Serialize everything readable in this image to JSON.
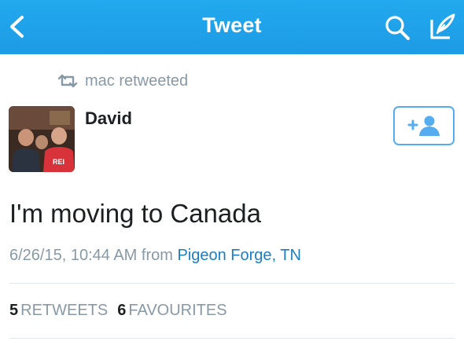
{
  "navbar": {
    "title": "Tweet",
    "back_icon": "chevron-left-icon",
    "search_icon": "search-icon",
    "compose_icon": "compose-icon",
    "color": "#1da1f2"
  },
  "retweet": {
    "icon": "retweet-icon",
    "text": "mac retweeted"
  },
  "tweet": {
    "author_name": "David",
    "avatar": "avatar-photo",
    "follow_icon": "add-user-icon",
    "text": "I'm moving to Canada",
    "timestamp": "6/26/15, 10:44 AM",
    "from_label": "from",
    "location": "Pigeon Forge, TN"
  },
  "stats": {
    "retweets_count": "5",
    "retweets_label": "RETWEETS",
    "favourites_count": "6",
    "favourites_label": "FAVOURITES"
  },
  "colors": {
    "accent": "#55acee",
    "link": "#1d7fc0",
    "muted": "#8899a6"
  }
}
